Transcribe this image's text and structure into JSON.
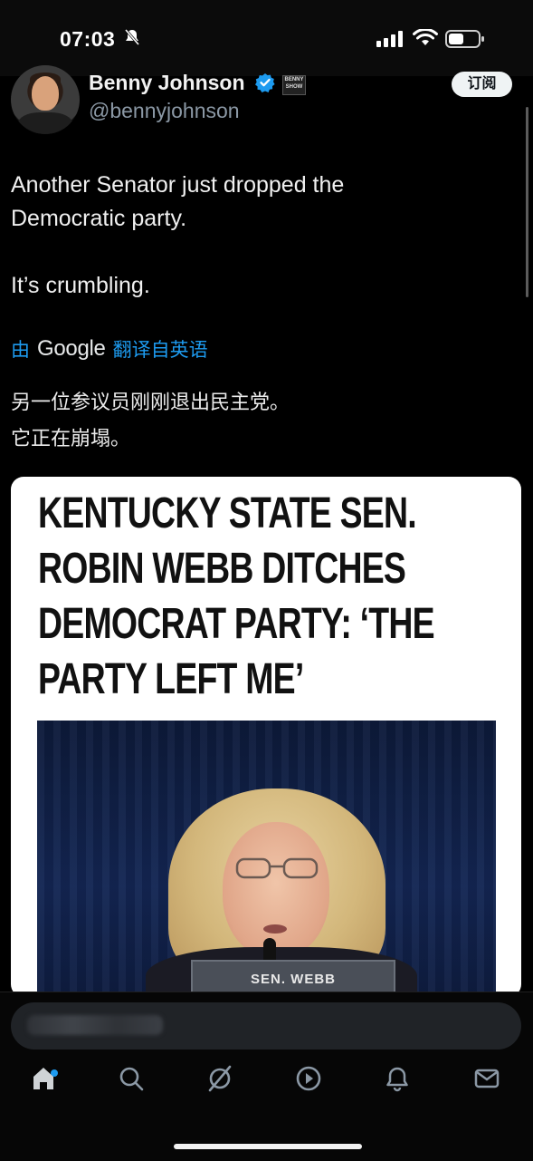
{
  "status_bar": {
    "time": "07:03"
  },
  "author": {
    "name": "Benny Johnson",
    "handle": "@bennyjohnson",
    "badge_text": "BENNY SHOW",
    "subscribe_label": "订阅"
  },
  "tweet": {
    "text_lines": [
      "Another Senator just dropped the",
      "Democratic party."
    ],
    "text_line_2": "It’s crumbling."
  },
  "translation_bar": {
    "prefix": "由",
    "brand": "Google",
    "suffix": "翻译自英语"
  },
  "translated_text": {
    "line1": "另一位参议员刚刚退出民主党。",
    "line2": "它正在崩塌。"
  },
  "media": {
    "headline_lines": [
      "KENTUCKY STATE SEN.",
      "ROBIN WEBB DITCHES",
      "DEMOCRAT PARTY: ‘THE",
      "PARTY LEFT ME’"
    ],
    "nameplate": "SEN. WEBB"
  },
  "bottom_nav": {
    "items": [
      "home-icon",
      "search-icon",
      "grok-icon",
      "video-icon",
      "notifications-icon",
      "messages-icon"
    ]
  },
  "colors": {
    "accent": "#1d9bf0",
    "background": "#000000",
    "text": "#e7e9ea",
    "muted": "#8b98a5"
  }
}
